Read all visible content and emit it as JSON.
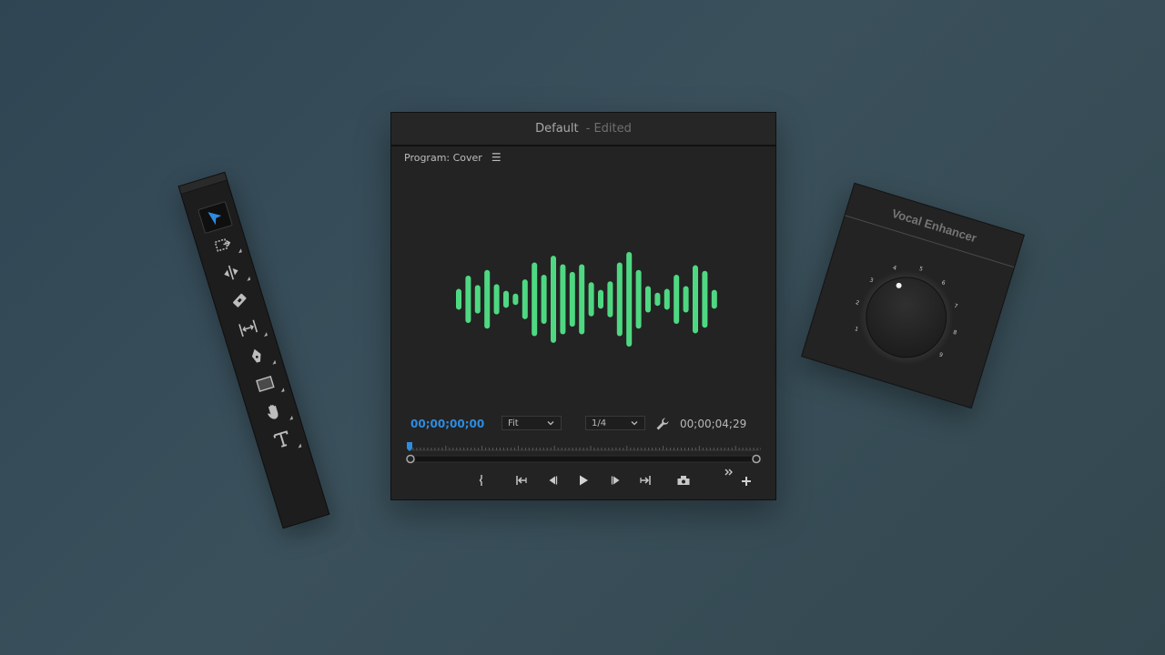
{
  "tools_panel": {
    "tools": [
      {
        "name": "selection-tool",
        "icon": "arrow-cursor-icon",
        "active": true
      },
      {
        "name": "track-select-tool",
        "icon": "track-select-icon",
        "active": false
      },
      {
        "name": "ripple-edit-tool",
        "icon": "ripple-edit-icon",
        "active": false
      },
      {
        "name": "razor-tool",
        "icon": "razor-icon",
        "active": false
      },
      {
        "name": "slip-tool",
        "icon": "slip-icon",
        "active": false
      },
      {
        "name": "pen-tool",
        "icon": "pen-icon",
        "active": false
      },
      {
        "name": "rectangle-tool",
        "icon": "rectangle-icon",
        "active": false
      },
      {
        "name": "hand-tool",
        "icon": "hand-icon",
        "active": false
      },
      {
        "name": "type-tool",
        "icon": "type-icon",
        "active": false
      }
    ]
  },
  "window": {
    "title": "Default",
    "title_status": "- Edited"
  },
  "program_monitor": {
    "panel_title": "Program: Cover",
    "menu_icon": "hamburger-menu-icon",
    "waveform_color": "#4fd882",
    "waveform_levels": [
      0.22,
      0.5,
      0.3,
      0.62,
      0.32,
      0.18,
      0.12,
      0.42,
      0.78,
      0.52,
      0.92,
      0.74,
      0.58,
      0.74,
      0.36,
      0.2,
      0.38,
      0.78,
      1.0,
      0.62,
      0.28,
      0.14,
      0.22,
      0.52,
      0.28,
      0.72,
      0.6,
      0.2
    ],
    "timecode_current": "00;00;00;00",
    "zoom_value": "Fit",
    "resolution_value": "1/4",
    "timecode_duration": "00;00;04;29",
    "playhead_position": 0,
    "accent_color": "#2e8ce0"
  },
  "transport": {
    "buttons": [
      {
        "name": "add-marker-button",
        "icon": "marker-icon"
      },
      {
        "name": "go-to-in-button",
        "icon": "go-to-in-icon"
      },
      {
        "name": "step-back-button",
        "icon": "step-back-icon"
      },
      {
        "name": "play-button",
        "icon": "play-icon"
      },
      {
        "name": "step-forward-button",
        "icon": "step-forward-icon"
      },
      {
        "name": "go-to-out-button",
        "icon": "go-to-out-icon"
      },
      {
        "name": "export-frame-button",
        "icon": "camera-icon"
      },
      {
        "name": "more-controls-button",
        "icon": "double-chevron-right-icon"
      },
      {
        "name": "button-editor-button",
        "icon": "plus-icon"
      }
    ]
  },
  "vocal_enhancer": {
    "title": "Vocal Enhancer",
    "scale_labels": [
      "1",
      "2",
      "3",
      "4",
      "5",
      "6",
      "7",
      "8",
      "9"
    ],
    "knob_value": 4
  }
}
